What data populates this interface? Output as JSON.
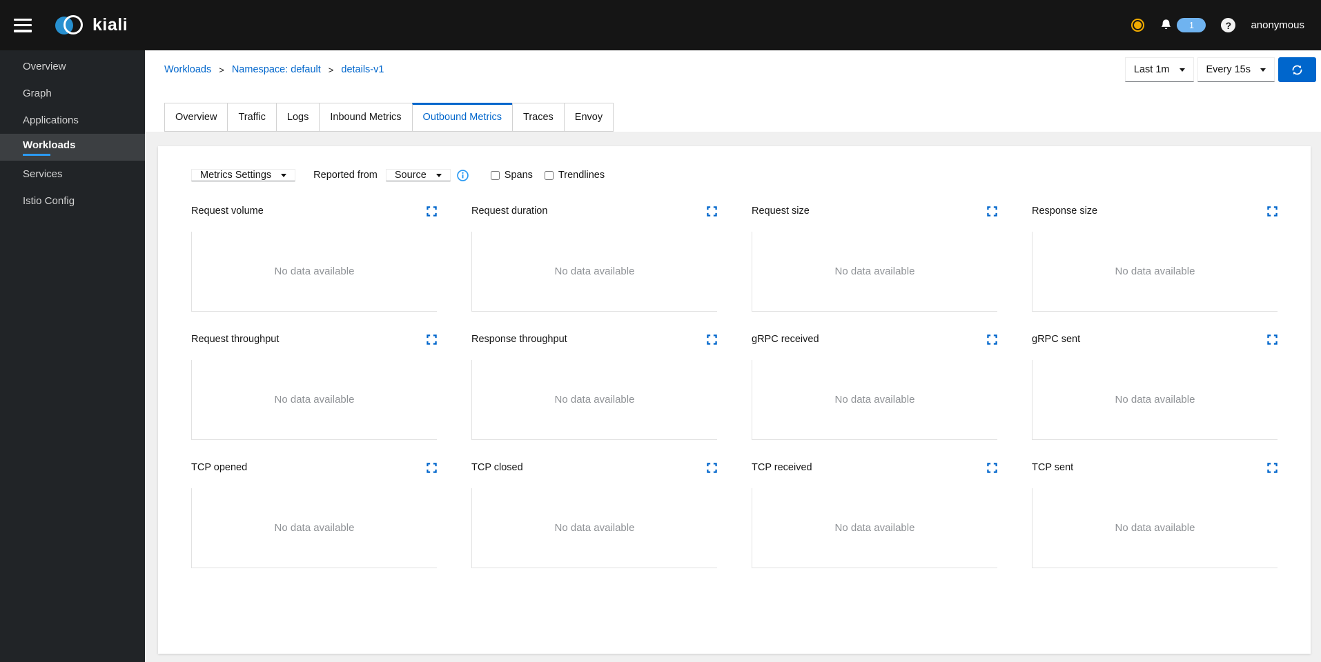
{
  "masthead": {
    "brand": "kiali",
    "notification_badge": "1",
    "user_label": "anonymous"
  },
  "sidebar": {
    "active_index": 3,
    "items": [
      {
        "label": "Overview"
      },
      {
        "label": "Graph"
      },
      {
        "label": "Applications"
      },
      {
        "label": "Workloads"
      },
      {
        "label": "Services"
      },
      {
        "label": "Istio Config"
      }
    ]
  },
  "breadcrumb": {
    "items": [
      {
        "label": "Workloads"
      },
      {
        "label": "Namespace: default"
      },
      {
        "label": "details-v1"
      }
    ],
    "separator": ">"
  },
  "toolbar": {
    "duration_value": "Last 1m",
    "refresh_value": "Every 15s"
  },
  "tabs": {
    "active_index": 4,
    "items": [
      {
        "label": "Overview"
      },
      {
        "label": "Traffic"
      },
      {
        "label": "Logs"
      },
      {
        "label": "Inbound Metrics"
      },
      {
        "label": "Outbound Metrics"
      },
      {
        "label": "Traces"
      },
      {
        "label": "Envoy"
      }
    ]
  },
  "settings": {
    "metrics_settings_label": "Metrics Settings",
    "reported_from_label": "Reported from",
    "reporter_value": "Source",
    "spans_label": "Spans",
    "spans_checked": false,
    "trendlines_label": "Trendlines",
    "trendlines_checked": false
  },
  "charts": {
    "empty_message": "No data available",
    "items": [
      {
        "title": "Request volume"
      },
      {
        "title": "Request duration"
      },
      {
        "title": "Request size"
      },
      {
        "title": "Response size"
      },
      {
        "title": "Request throughput"
      },
      {
        "title": "Response throughput"
      },
      {
        "title": "gRPC received"
      },
      {
        "title": "gRPC sent"
      },
      {
        "title": "TCP opened"
      },
      {
        "title": "TCP closed"
      },
      {
        "title": "TCP received"
      },
      {
        "title": "TCP sent"
      }
    ]
  },
  "colors": {
    "accent_blue": "#0066cc",
    "info_blue": "#2b9af3",
    "status_amber": "#f0ab00",
    "masthead_bg": "#151515",
    "sidebar_bg": "#212427",
    "active_nav_bg": "#3c3f42",
    "badge_blue": "#6fb3f0"
  }
}
